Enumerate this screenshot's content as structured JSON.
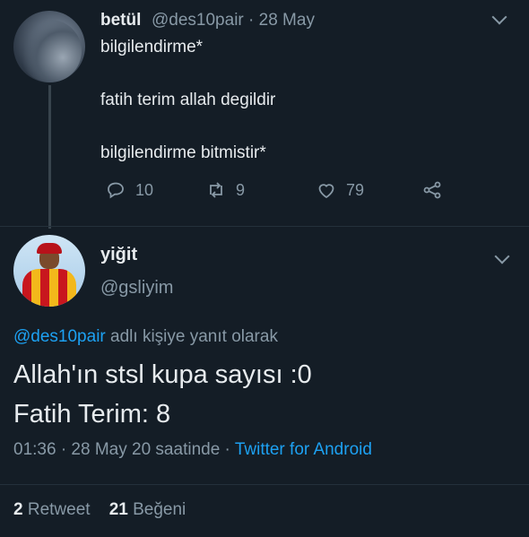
{
  "parent": {
    "name": "betül",
    "handle": "@des10pair",
    "date": "· 28 May",
    "lines": [
      "bilgilendirme*",
      "fatih terim allah degildir",
      "bilgilendirme bitmistir*"
    ],
    "actions": {
      "replies": "10",
      "retweets": "9",
      "likes": "79"
    }
  },
  "reply": {
    "name": "yiğit",
    "handle": "@gsliyim",
    "replying_handle": "@des10pair",
    "replying_suffix": " adlı kişiye yanıt olarak",
    "text_lines": [
      "Allah'ın stsl kupa sayısı :0",
      "Fatih Terim: 8"
    ],
    "time": "01:36 · 28 May 20 saatinde ·",
    "source": "Twitter for Android",
    "retweet_count": "2",
    "retweet_label": "Retweet",
    "like_count": "21",
    "like_label": "Beğeni"
  },
  "colors": {
    "background": "#141d26",
    "link": "#1da1f2",
    "muted": "#8899a6"
  }
}
